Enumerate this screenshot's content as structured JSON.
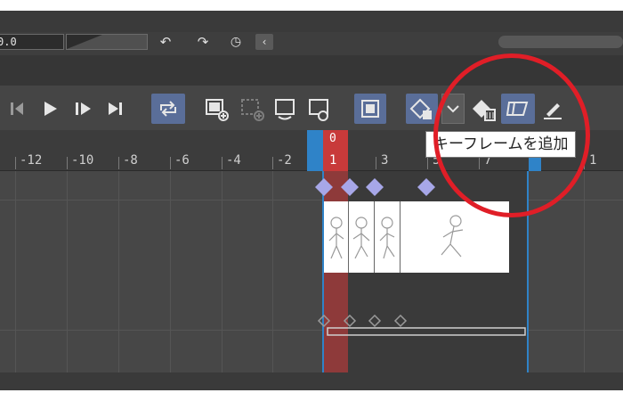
{
  "top_bar": {
    "field_value": "0.0"
  },
  "ruler": {
    "labels": [
      "-12",
      "-10",
      "-8",
      "-6",
      "-4",
      "-2",
      "1",
      "3",
      "5",
      "7",
      "1"
    ],
    "current_frame_label": "1",
    "current_frame_marker": "0"
  },
  "tooltip": {
    "text": "キーフレームを追加"
  },
  "colors": {
    "accent": "#5a6e99",
    "playhead": "#c83a3a",
    "highlight_circle": "#e01e27",
    "keyframe": "#a7a7e8"
  },
  "toolbar": {
    "icons": [
      "prev-frame-icon",
      "play-icon",
      "next-frame-icon",
      "last-frame-icon",
      "loop-icon",
      "new-cel-icon",
      "delete-cel-icon",
      "cel-a-icon",
      "cel-b-icon",
      "onion-skin-icon",
      "keyframe-toggle-icon",
      "dropdown-icon",
      "add-keyframe-icon",
      "keyframe-mode-icon",
      "edit-icon"
    ]
  }
}
